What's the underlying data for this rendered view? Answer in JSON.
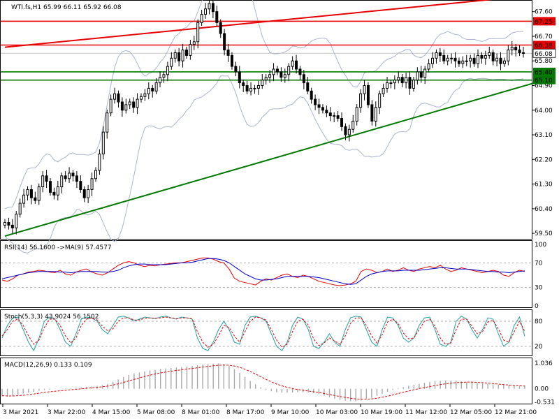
{
  "chart_data": [
    {
      "type": "candlestick",
      "header": {
        "symbol": "WTI.fs,H1",
        "quote": "65.99 66.11 65.92 66.08"
      },
      "price_scale": [
        "67.60",
        "66.70",
        "65.80",
        "64.90",
        "64.00",
        "63.10",
        "62.20",
        "61.30",
        "60.40",
        "59.50"
      ],
      "y_range": [
        59.3,
        68.0
      ],
      "levels": [
        {
          "label": "67.25",
          "value": 67.25,
          "color": "#e60000"
        },
        {
          "label": "66.38",
          "value": 66.38,
          "color": "#e60000"
        },
        {
          "label": "65.40",
          "value": 65.4,
          "color": "#007a00"
        },
        {
          "label": "65.10",
          "value": 65.1,
          "color": "#007a00"
        }
      ],
      "current_price": {
        "label": "66.08",
        "value": 66.08
      },
      "trendlines": [
        {
          "color": "#e60000",
          "from": [
            0,
            66.3
          ],
          "to": [
            140,
            68.2
          ]
        },
        {
          "color": "#007a00",
          "from": [
            0,
            59.4
          ],
          "to": [
            140,
            65.0
          ]
        }
      ],
      "closes": [
        59.9,
        59.8,
        59.7,
        60.2,
        60.6,
        60.9,
        61.1,
        60.8,
        60.7,
        61.2,
        61.6,
        61.4,
        61.0,
        60.9,
        61.2,
        61.6,
        61.5,
        61.7,
        61.6,
        61.4,
        61.1,
        60.8,
        61.1,
        61.5,
        61.8,
        62.4,
        63.2,
        63.9,
        64.4,
        64.6,
        64.3,
        64.0,
        64.2,
        64.3,
        64.1,
        64.4,
        64.5,
        64.6,
        64.8,
        64.7,
        65.0,
        65.2,
        65.3,
        65.6,
        65.9,
        66.1,
        65.8,
        66.2,
        66.0,
        66.4,
        66.5,
        67.2,
        67.5,
        67.7,
        67.9,
        67.6,
        67.2,
        66.8,
        66.2,
        66.0,
        65.6,
        65.4,
        65.0,
        64.9,
        64.7,
        64.8,
        64.8,
        64.9,
        65.1,
        65.2,
        65.3,
        65.5,
        65.4,
        65.2,
        65.3,
        65.6,
        65.8,
        65.5,
        65.3,
        65.0,
        64.7,
        64.4,
        64.2,
        64.1,
        64.0,
        63.9,
        63.8,
        63.8,
        63.7,
        63.4,
        63.1,
        63.3,
        63.6,
        64.1,
        64.6,
        64.9,
        64.2,
        63.6,
        64.1,
        64.6,
        64.8,
        65.0,
        65.0,
        65.1,
        65.2,
        65.0,
        65.2,
        64.8,
        65.1,
        65.4,
        65.2,
        65.5,
        65.7,
        65.9,
        66.1,
        66.0,
        65.8,
        65.9,
        65.9,
        65.8,
        65.7,
        65.8,
        65.8,
        65.9,
        65.7,
        66.0,
        65.9,
        66.0,
        66.1,
        65.8,
        65.9,
        65.7,
        65.8,
        66.2,
        66.3,
        66.2,
        66.1,
        66.08
      ]
    },
    {
      "type": "line",
      "header": "RSI(14) 56.1600  ->MA(9) 57.4577",
      "scale": [
        "100",
        "70",
        "30",
        "0"
      ],
      "levels": [
        70,
        30
      ],
      "y_range": [
        0,
        100
      ],
      "series": [
        {
          "color": "#e60000",
          "values": [
            42,
            40,
            44,
            50,
            52,
            55,
            56,
            58,
            57,
            55,
            54,
            58,
            52,
            50,
            55,
            58,
            60,
            55,
            52,
            50,
            54,
            60,
            66,
            70,
            72,
            70,
            66,
            64,
            66,
            65,
            67,
            68,
            69,
            70,
            70,
            72,
            74,
            76,
            78,
            78,
            76,
            72,
            70,
            60,
            45,
            40,
            38,
            36,
            34,
            40,
            44,
            42,
            46,
            50,
            52,
            48,
            46,
            50,
            48,
            44,
            40,
            38,
            36,
            34,
            33,
            34,
            36,
            40,
            56,
            60,
            58,
            54,
            56,
            60,
            56,
            58,
            62,
            58,
            56,
            60,
            62,
            64,
            62,
            66,
            60,
            56,
            58,
            62,
            60,
            58,
            56,
            54,
            56,
            58,
            56,
            50,
            48,
            54,
            58,
            56
          ]
        },
        {
          "color": "#0000cc",
          "values": [
            44,
            46,
            48,
            50,
            52,
            54,
            55,
            56,
            56,
            56,
            56,
            55,
            55,
            54,
            55,
            56,
            56,
            56,
            56,
            55,
            55,
            56,
            58,
            62,
            65,
            67,
            68,
            68,
            67,
            67,
            67,
            67,
            68,
            69,
            70,
            70,
            71,
            73,
            75,
            77,
            77,
            76,
            74,
            70,
            64,
            58,
            52,
            48,
            44,
            42,
            42,
            43,
            44,
            46,
            48,
            48,
            48,
            48,
            48,
            47,
            46,
            44,
            42,
            40,
            38,
            36,
            35,
            36,
            42,
            48,
            52,
            54,
            56,
            57,
            57,
            57,
            58,
            58,
            58,
            58,
            59,
            60,
            61,
            62,
            62,
            61,
            60,
            60,
            60,
            59,
            58,
            57,
            56,
            56,
            55,
            55,
            54,
            55,
            56,
            57
          ]
        }
      ]
    },
    {
      "type": "line",
      "header": "Stoch(5,3,3) 43.9024 56.1502",
      "scale": [
        "80",
        "20"
      ],
      "levels": [
        80,
        20
      ],
      "y_range": [
        0,
        100
      ],
      "series": [
        {
          "color": "#20a0a0",
          "values": [
            40,
            70,
            88,
            90,
            60,
            30,
            10,
            40,
            80,
            90,
            85,
            60,
            30,
            20,
            50,
            85,
            90,
            88,
            80,
            60,
            50,
            70,
            90,
            92,
            88,
            80,
            85,
            90,
            88,
            86,
            90,
            92,
            88,
            85,
            90,
            88,
            85,
            40,
            15,
            10,
            30,
            60,
            80,
            60,
            30,
            25,
            70,
            90,
            92,
            88,
            80,
            50,
            20,
            10,
            30,
            70,
            90,
            85,
            60,
            20,
            15,
            30,
            50,
            30,
            20,
            60,
            88,
            92,
            90,
            60,
            30,
            20,
            60,
            90,
            88,
            70,
            40,
            30,
            40,
            70,
            88,
            90,
            60,
            25,
            20,
            30,
            80,
            92,
            85,
            60,
            40,
            60,
            88,
            85,
            50,
            20,
            30,
            70,
            90,
            44
          ]
        },
        {
          "color": "#e60000",
          "values": [
            45,
            60,
            80,
            85,
            70,
            45,
            25,
            35,
            65,
            85,
            85,
            70,
            45,
            28,
            40,
            70,
            85,
            88,
            83,
            68,
            57,
            62,
            80,
            88,
            88,
            83,
            83,
            87,
            88,
            87,
            88,
            90,
            88,
            86,
            88,
            88,
            86,
            55,
            30,
            18,
            25,
            45,
            70,
            65,
            45,
            30,
            55,
            80,
            90,
            88,
            83,
            60,
            35,
            18,
            25,
            55,
            80,
            85,
            70,
            38,
            22,
            28,
            40,
            33,
            25,
            45,
            75,
            88,
            88,
            70,
            45,
            28,
            48,
            78,
            85,
            75,
            52,
            38,
            40,
            60,
            80,
            85,
            68,
            40,
            25,
            28,
            60,
            85,
            85,
            68,
            50,
            55,
            78,
            82,
            62,
            35,
            30,
            55,
            80,
            56
          ]
        }
      ]
    },
    {
      "type": "bar",
      "header": "MACD(12,26,9) 0.133 0.109",
      "scale": [
        "1.036",
        "0.00",
        "-0.531"
      ],
      "y_range": [
        -0.6,
        1.15
      ],
      "histogram": [
        -0.3,
        -0.32,
        -0.3,
        -0.25,
        -0.2,
        -0.16,
        -0.12,
        -0.08,
        -0.05,
        -0.03,
        -0.01,
        0.0,
        0.01,
        0.02,
        0.04,
        0.06,
        0.08,
        0.1,
        0.12,
        0.15,
        0.2,
        0.28,
        0.38,
        0.48,
        0.56,
        0.62,
        0.66,
        0.7,
        0.74,
        0.77,
        0.8,
        0.82,
        0.84,
        0.86,
        0.88,
        0.9,
        0.92,
        0.95,
        0.98,
        1.0,
        1.02,
        1.03,
        1.0,
        0.92,
        0.8,
        0.64,
        0.48,
        0.32,
        0.18,
        0.06,
        -0.04,
        -0.1,
        -0.14,
        -0.16,
        -0.16,
        -0.15,
        -0.14,
        -0.14,
        -0.15,
        -0.18,
        -0.22,
        -0.28,
        -0.34,
        -0.4,
        -0.45,
        -0.48,
        -0.5,
        -0.5,
        -0.47,
        -0.42,
        -0.36,
        -0.28,
        -0.2,
        -0.12,
        -0.05,
        0.02,
        0.07,
        0.12,
        0.16,
        0.2,
        0.24,
        0.28,
        0.3,
        0.32,
        0.33,
        0.33,
        0.32,
        0.3,
        0.28,
        0.26,
        0.24,
        0.22,
        0.2,
        0.18,
        0.17,
        0.16,
        0.15,
        0.14,
        0.13,
        0.133
      ],
      "signal": [
        -0.28,
        -0.29,
        -0.29,
        -0.28,
        -0.26,
        -0.24,
        -0.21,
        -0.18,
        -0.15,
        -0.12,
        -0.1,
        -0.08,
        -0.06,
        -0.04,
        -0.02,
        0.0,
        0.02,
        0.04,
        0.06,
        0.08,
        0.11,
        0.15,
        0.2,
        0.26,
        0.32,
        0.38,
        0.44,
        0.5,
        0.55,
        0.6,
        0.64,
        0.68,
        0.71,
        0.74,
        0.77,
        0.8,
        0.82,
        0.85,
        0.88,
        0.9,
        0.93,
        0.95,
        0.96,
        0.95,
        0.92,
        0.87,
        0.79,
        0.7,
        0.6,
        0.49,
        0.38,
        0.28,
        0.19,
        0.12,
        0.06,
        0.01,
        -0.03,
        -0.06,
        -0.09,
        -0.12,
        -0.15,
        -0.19,
        -0.23,
        -0.27,
        -0.31,
        -0.35,
        -0.38,
        -0.41,
        -0.42,
        -0.42,
        -0.41,
        -0.38,
        -0.34,
        -0.3,
        -0.25,
        -0.19,
        -0.14,
        -0.09,
        -0.04,
        0.01,
        0.05,
        0.09,
        0.13,
        0.17,
        0.2,
        0.23,
        0.25,
        0.26,
        0.27,
        0.27,
        0.26,
        0.25,
        0.23,
        0.21,
        0.19,
        0.17,
        0.15,
        0.13,
        0.12,
        0.109
      ]
    }
  ],
  "time_axis": [
    "3 Mar 2021",
    "3 Mar 22:00",
    "4 Mar 15:00",
    "5 Mar 08:00",
    "8 Mar 01:00",
    "8 Mar 17:00",
    "9 Mar 10:00",
    "10 Mar 03:00",
    "10 Mar 19:00",
    "11 Mar 12:00",
    "12 Mar 05:00",
    "12 Mar 21:00"
  ]
}
